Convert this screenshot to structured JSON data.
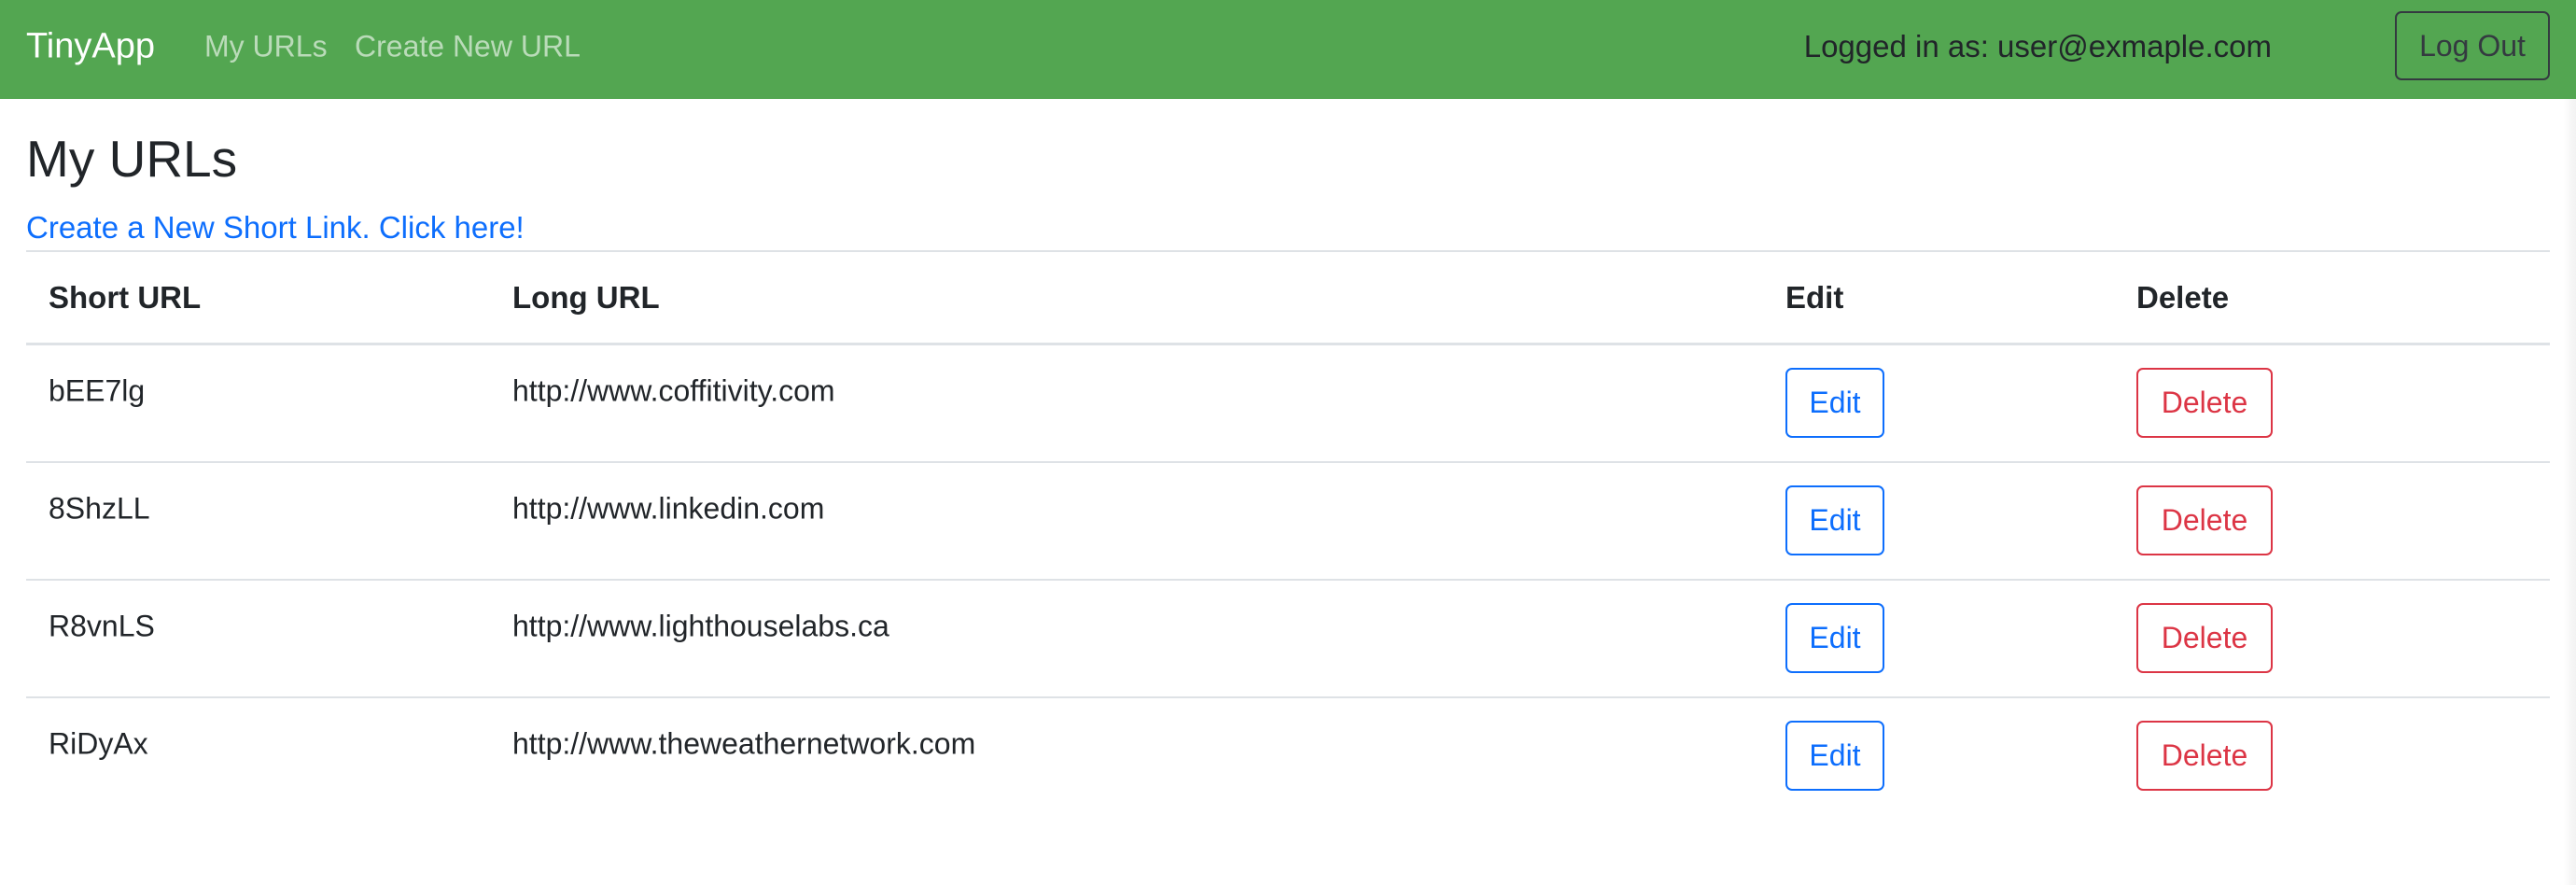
{
  "navbar": {
    "brand": "TinyApp",
    "links": [
      "My URLs",
      "Create New URL"
    ],
    "logged_in_text": "Logged in as: user@exmaple.com",
    "logout_label": "Log Out",
    "bg_color": "#53a651"
  },
  "main": {
    "title": "My URLs",
    "create_link": "Create a New Short Link. Click here!",
    "table": {
      "columns": [
        "Short URL",
        "Long URL",
        "Edit",
        "Delete"
      ],
      "rows": [
        {
          "short": "bEE7lg",
          "long": "http://www.coffitivity.com",
          "edit": "Edit",
          "delete": "Delete"
        },
        {
          "short": "8ShzLL",
          "long": "http://www.linkedin.com",
          "edit": "Edit",
          "delete": "Delete"
        },
        {
          "short": "R8vnLS",
          "long": "http://www.lighthouselabs.ca",
          "edit": "Edit",
          "delete": "Delete"
        },
        {
          "short": "RiDyAx",
          "long": "http://www.theweathernetwork.com",
          "edit": "Edit",
          "delete": "Delete"
        }
      ]
    }
  }
}
